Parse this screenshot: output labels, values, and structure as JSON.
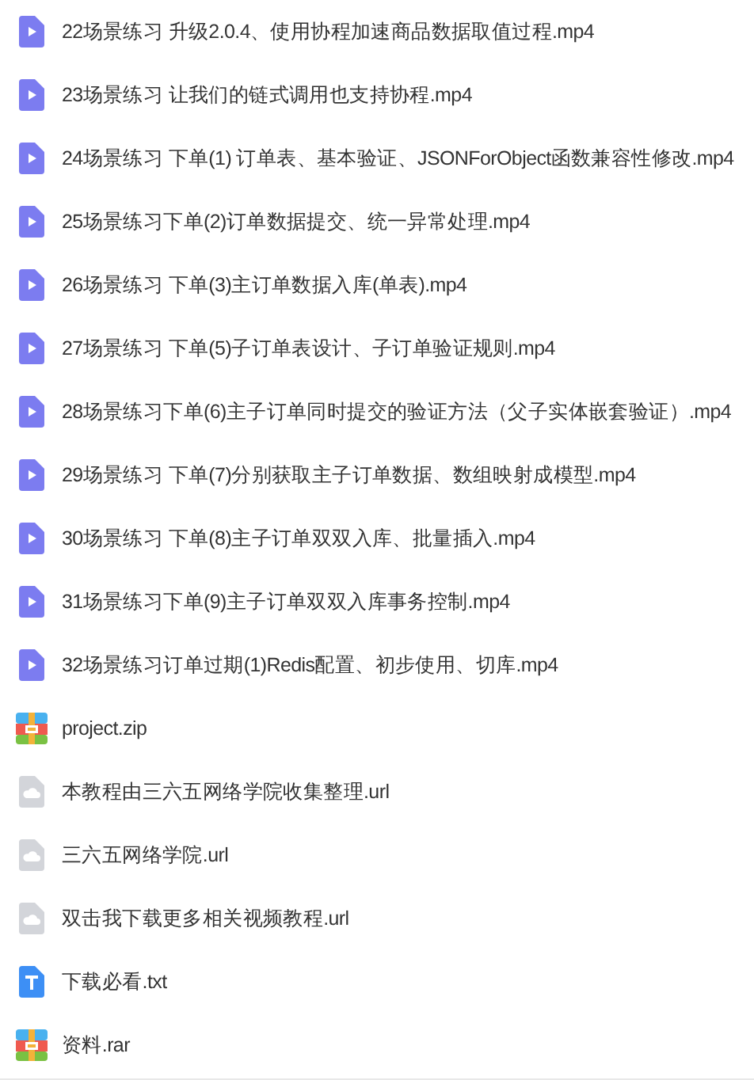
{
  "files": [
    {
      "kind": "video",
      "name": "22场景练习 升级2.0.4、使用协程加速商品数据取值过程.mp4"
    },
    {
      "kind": "video",
      "name": "23场景练习 让我们的链式调用也支持协程.mp4"
    },
    {
      "kind": "video",
      "name": "24场景练习 下单(1) 订单表、基本验证、JSONForObject函数兼容性修改.mp4"
    },
    {
      "kind": "video",
      "name": "25场景练习下单(2)订单数据提交、统一异常处理.mp4"
    },
    {
      "kind": "video",
      "name": "26场景练习 下单(3)主订单数据入库(单表).mp4"
    },
    {
      "kind": "video",
      "name": "27场景练习 下单(5)子订单表设计、子订单验证规则.mp4"
    },
    {
      "kind": "video",
      "name": "28场景练习下单(6)主子订单同时提交的验证方法（父子实体嵌套验证）.mp4"
    },
    {
      "kind": "video",
      "name": "29场景练习 下单(7)分别获取主子订单数据、数组映射成模型.mp4"
    },
    {
      "kind": "video",
      "name": "30场景练习 下单(8)主子订单双双入库、批量插入.mp4"
    },
    {
      "kind": "video",
      "name": "31场景练习下单(9)主子订单双双入库事务控制.mp4"
    },
    {
      "kind": "video",
      "name": "32场景练习订单过期(1)Redis配置、初步使用、切库.mp4"
    },
    {
      "kind": "archive",
      "name": "project.zip"
    },
    {
      "kind": "link",
      "name": "本教程由三六五网络学院收集整理.url"
    },
    {
      "kind": "link",
      "name": "三六五网络学院.url"
    },
    {
      "kind": "link",
      "name": "双击我下载更多相关视频教程.url"
    },
    {
      "kind": "text",
      "name": "下载必看.txt"
    },
    {
      "kind": "archive",
      "name": "资料.rar"
    }
  ]
}
